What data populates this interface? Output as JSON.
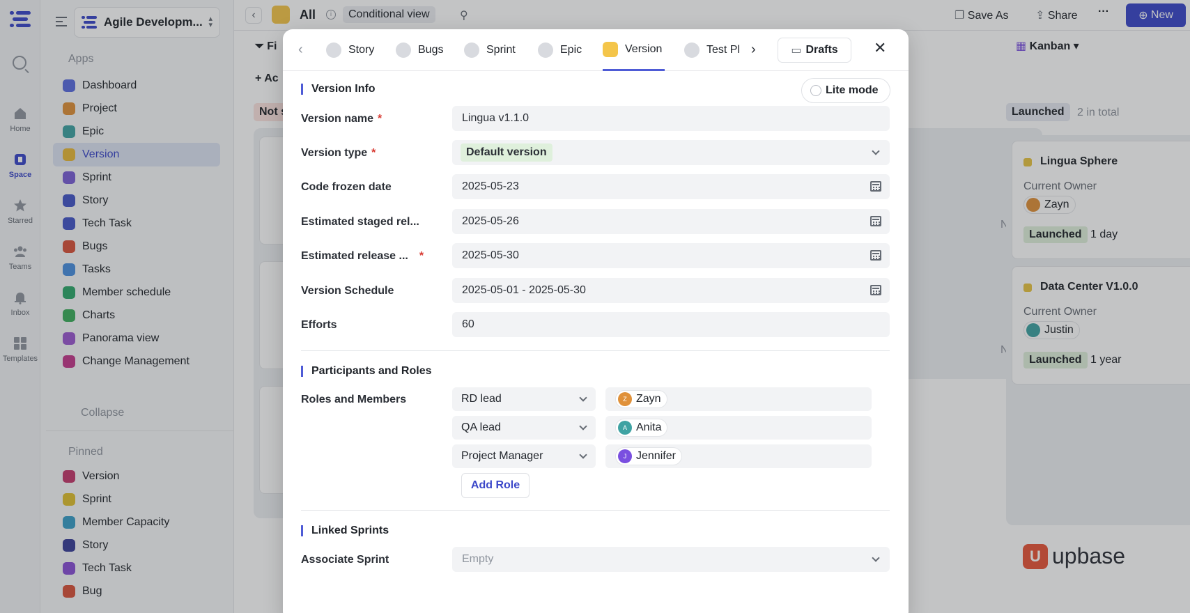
{
  "rail": {
    "items": [
      {
        "label": "Home",
        "icon": "home-icon"
      },
      {
        "label": "Space",
        "icon": "space-icon"
      },
      {
        "label": "Starred",
        "icon": "star-icon"
      },
      {
        "label": "Teams",
        "icon": "teams-icon"
      },
      {
        "label": "Inbox",
        "icon": "bell-icon"
      },
      {
        "label": "Templates",
        "icon": "templates-icon"
      }
    ]
  },
  "sidebar": {
    "workspace": "Agile Developm...",
    "apps_title": "Apps",
    "apps": [
      {
        "label": "Dashboard",
        "color": "#5b6ce0"
      },
      {
        "label": "Project",
        "color": "#e0913a"
      },
      {
        "label": "Epic",
        "color": "#3fa3a3"
      },
      {
        "label": "Version",
        "color": "#e8b93a"
      },
      {
        "label": "Sprint",
        "color": "#7a5fd6"
      },
      {
        "label": "Story",
        "color": "#4456c8"
      },
      {
        "label": "Tech Task",
        "color": "#4456c8"
      },
      {
        "label": "Bugs",
        "color": "#d9523b"
      },
      {
        "label": "Tasks",
        "color": "#4a8fe0"
      },
      {
        "label": "Member schedule",
        "color": "#2fa86b"
      },
      {
        "label": "Charts",
        "color": "#3cae5c"
      },
      {
        "label": "Panorama view",
        "color": "#9b59d0"
      },
      {
        "label": "Change Management",
        "color": "#c43a8c"
      }
    ],
    "collapse": "Collapse",
    "pinned_title": "Pinned",
    "pinned": [
      {
        "label": "Version",
        "color": "#c43a6c"
      },
      {
        "label": "Sprint",
        "color": "#e0c030"
      },
      {
        "label": "Member Capacity",
        "color": "#3a9ec8"
      },
      {
        "label": "Story",
        "color": "#3a3f99"
      },
      {
        "label": "Tech Task",
        "color": "#8a4fd6"
      },
      {
        "label": "Bug",
        "color": "#d9523b"
      }
    ]
  },
  "topbar": {
    "title": "All",
    "view": "Conditional view",
    "save_as": "Save As",
    "share": "Share",
    "new": "New"
  },
  "board": {
    "filter": "Fi",
    "add": "Ac",
    "not_started": "Not s",
    "launched_col": "Launched",
    "launched_count": "2 in total",
    "kanban": "Kanban",
    "none": "None",
    "cards": [
      {
        "title": "Lingua Sphere",
        "owner_label": "Current Owner",
        "owner": "Zayn",
        "status": "Launched",
        "duration": "1 day"
      },
      {
        "title": "Data Center V1.0.0",
        "owner_label": "Current Owner",
        "owner": "Justin",
        "status": "Launched",
        "duration": "1 year"
      }
    ]
  },
  "modal": {
    "tabs": [
      "Story",
      "Bugs",
      "Sprint",
      "Epic",
      "Version",
      "Test Pl"
    ],
    "drafts": "Drafts",
    "lite_mode": "Lite mode",
    "version_info_title": "Version Info",
    "fields": {
      "version_name": {
        "label": "Version name",
        "value": "Lingua v1.1.0"
      },
      "version_type": {
        "label": "Version type",
        "value": "Default version"
      },
      "code_frozen": {
        "label": "Code frozen date",
        "value": "2025-05-23"
      },
      "staged_release": {
        "label": "Estimated staged rel...",
        "value": "2025-05-26"
      },
      "release": {
        "label": "Estimated release ...",
        "value": "2025-05-30"
      },
      "schedule": {
        "label": "Version Schedule",
        "value": "2025-05-01 - 2025-05-30"
      },
      "efforts": {
        "label": "Efforts",
        "value": "60"
      }
    },
    "participants_title": "Participants and Roles",
    "roles_label": "Roles and Members",
    "roles": [
      {
        "role": "RD lead",
        "member": "Zayn",
        "avatar_color": "#e0913a"
      },
      {
        "role": "QA lead",
        "member": "Anita",
        "avatar_color": "#3fa3a3"
      },
      {
        "role": "Project Manager",
        "member": "Jennifer",
        "avatar_color": "#7a4fe0"
      }
    ],
    "add_role": "Add Role",
    "linked_title": "Linked Sprints",
    "associate_label": "Associate Sprint",
    "associate_value": "Empty"
  },
  "brand": {
    "name": "upbase",
    "color": "#e8553a"
  }
}
